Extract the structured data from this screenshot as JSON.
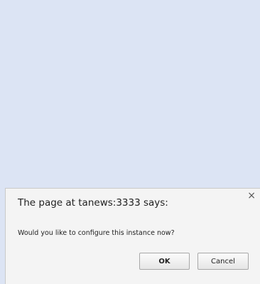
{
  "dialog": {
    "title": "The page at tanews:3333 says:",
    "close_glyph": "×",
    "message": "Would you like to configure this instance now?",
    "ok_label": "OK",
    "cancel_label": "Cancel"
  }
}
